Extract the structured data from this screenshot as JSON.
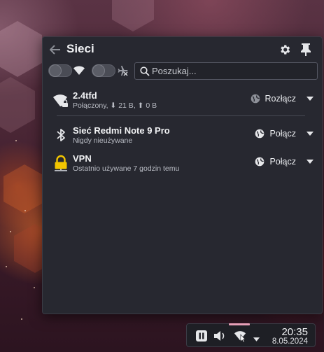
{
  "header": {
    "title": "Sieci"
  },
  "search": {
    "placeholder": "Poszukaj..."
  },
  "connections": [
    {
      "name": "2.4tfd",
      "status": "Połączony, ⬇ 21 B, ⬆ 0 B",
      "action": "Rozłącz",
      "icon": "wifi-lock-icon"
    },
    {
      "name": "Sieć Redmi Note 9 Pro",
      "status": "Nigdy nieużywane",
      "action": "Połącz",
      "icon": "bluetooth-icon"
    },
    {
      "name": "VPN",
      "status": "Ostatnio używane 7 godzin temu",
      "action": "Połącz",
      "icon": "vpn-lock-icon"
    }
  ],
  "taskbar": {
    "time": "20:35",
    "date": "8.05.2024"
  },
  "colors": {
    "panel_bg": "#272830",
    "accent_highlight": "#e8a0b8",
    "vpn_lock": "#f2c500"
  }
}
